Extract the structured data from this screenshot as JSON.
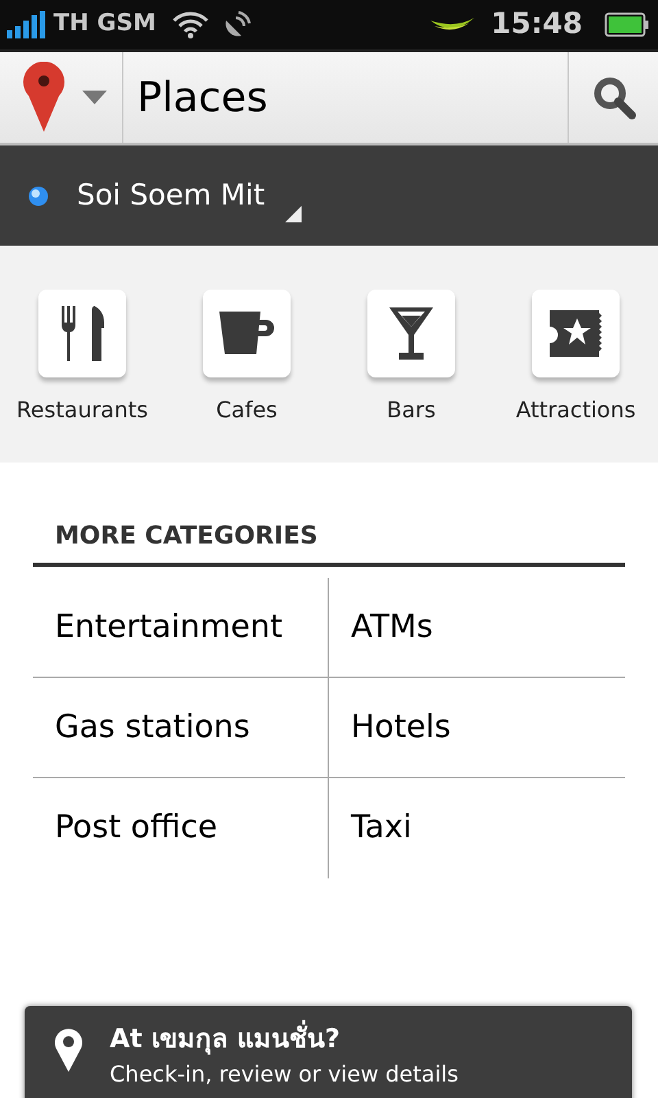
{
  "status_bar": {
    "carrier": "TH GSM",
    "time": "15:48"
  },
  "action_bar": {
    "title": "Places"
  },
  "location": {
    "name": "Soi Soem Mit"
  },
  "categories": [
    {
      "label": "Restaurants"
    },
    {
      "label": "Cafes"
    },
    {
      "label": "Bars"
    },
    {
      "label": "Attractions"
    }
  ],
  "more_categories": {
    "heading": "MORE CATEGORIES",
    "items": [
      "Entertainment",
      "ATMs",
      "Gas stations",
      "Hotels",
      "Post office",
      "Taxi"
    ]
  },
  "checkin_prompt": {
    "title": "At เขมกุล แมนชั่น?",
    "subtitle": "Check-in, review or view details"
  }
}
